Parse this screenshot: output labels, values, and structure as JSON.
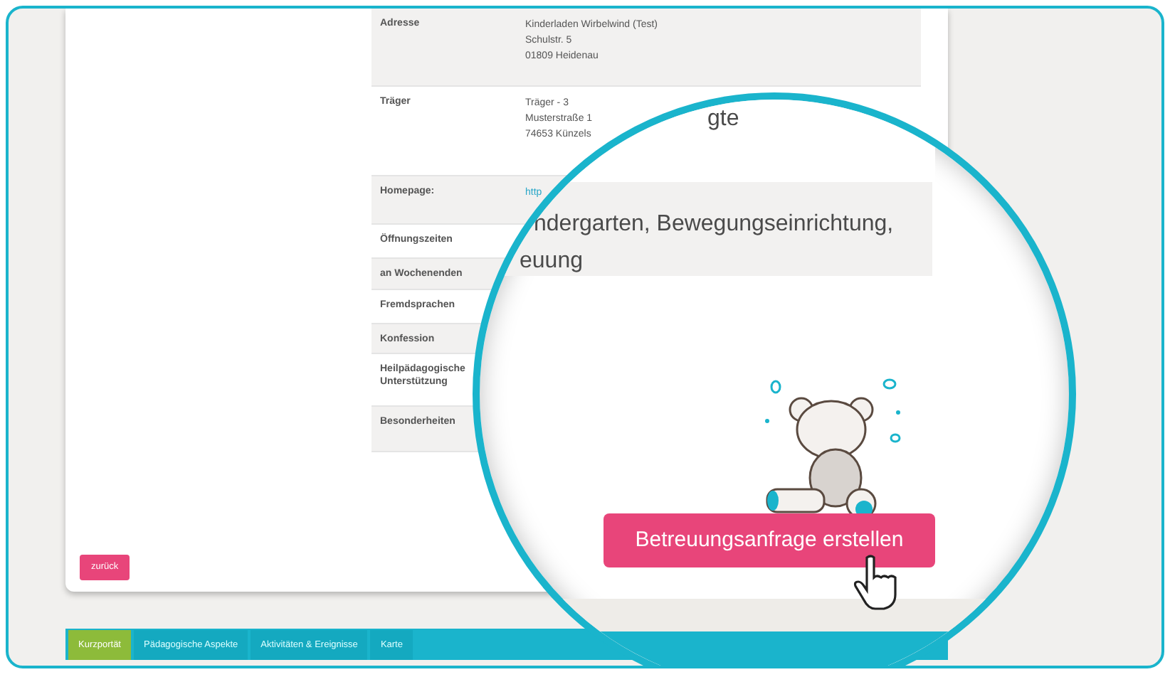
{
  "details": [
    {
      "label": "Adresse",
      "lines": [
        "Kinderladen Wirbelwind (Test)",
        "Schulstr. 5",
        "01809 Heidenau"
      ]
    },
    {
      "label": "Träger",
      "lines": [
        "Träger - 3",
        "Musterstraße 1",
        "74653 Künzels"
      ]
    },
    {
      "label": "Homepage:",
      "link": "http"
    },
    {
      "label": "Öffnungszeiten"
    },
    {
      "label": "an Wochenenden"
    },
    {
      "label": "Fremdsprachen"
    },
    {
      "label": "Konfession"
    },
    {
      "label": "Heilpädagogische Unterstützung"
    },
    {
      "label": "Besonderheiten"
    }
  ],
  "back_button": "zurück",
  "tabs": [
    {
      "label": "Kurzportät",
      "selected": true
    },
    {
      "label": "Pädagogische Aspekte",
      "selected": false
    },
    {
      "label": "Aktivitäten & Ereignisse",
      "selected": false
    },
    {
      "label": "Karte",
      "selected": false
    }
  ],
  "magnifier": {
    "texts": [
      "gte",
      "ndergarten, Bewegungseinrichtung,",
      "euung"
    ],
    "button": "Betreuungsanfrage erstellen"
  }
}
